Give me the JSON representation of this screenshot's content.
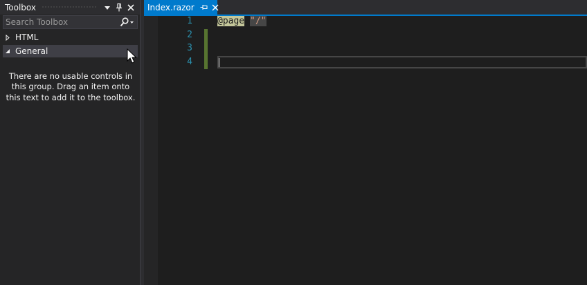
{
  "toolbox": {
    "title": "Toolbox",
    "search_placeholder": "Search Toolbox",
    "groups": [
      {
        "label": "HTML",
        "expanded": false
      },
      {
        "label": "General",
        "expanded": true
      }
    ],
    "empty_message": "There are no usable controls in this group. Drag an item onto this text to add it to the toolbox."
  },
  "editor": {
    "tab": {
      "title": "Index.razor"
    },
    "line_numbers": [
      "1",
      "2",
      "3",
      "4"
    ],
    "code": {
      "line1": {
        "directive": "@page",
        "string": "\"/\""
      }
    }
  },
  "colors": {
    "accent": "#007acc",
    "line_number": "#2b91af",
    "change_margin": "#577430",
    "directive_highlight": "#c4c79a",
    "string": "#d69d85"
  }
}
